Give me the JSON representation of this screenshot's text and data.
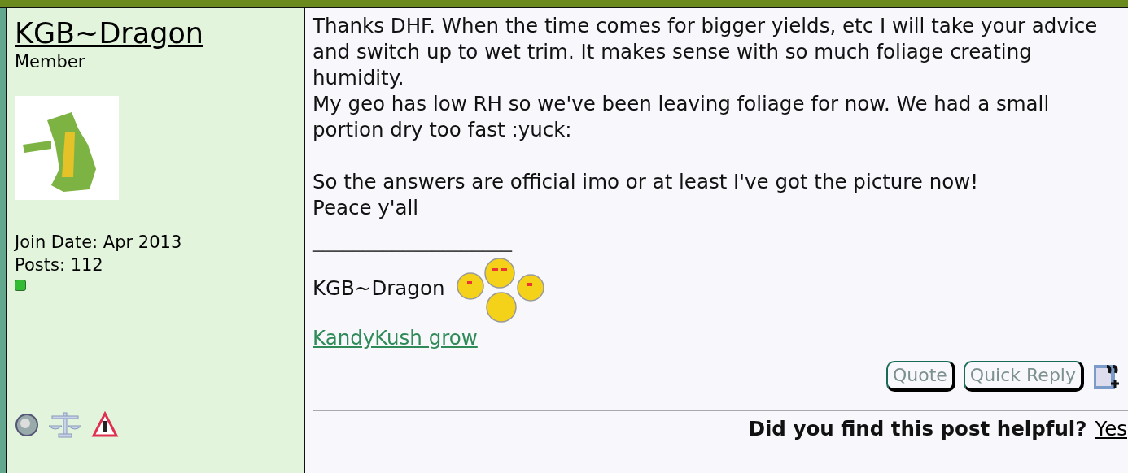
{
  "user": {
    "name": "KGB~Dragon",
    "rank": "Member",
    "join_date": "Join Date: Apr 2013",
    "posts": "Posts: 112",
    "online": true
  },
  "post": {
    "paragraphs": [
      [
        "Thanks DHF. When the time comes for bigger yields, etc I will take your advice and switch up to wet trim. It makes sense with so much foliage creating humidity.",
        "My geo has low RH so we've been leaving foliage for now. We had a small portion dry too fast :yuck:"
      ],
      [
        "So the answers are official imo or at least I've got the picture now!",
        "Peace y'all"
      ]
    ],
    "signature_rule": "____________________",
    "signature_name": "KGB~Dragon",
    "signature_link": "KandyKush grow",
    "buttons": [
      "Quote",
      "Quick Reply"
    ],
    "helpful_question": "Did you find this post helpful?",
    "helpful_answer": "Yes"
  }
}
